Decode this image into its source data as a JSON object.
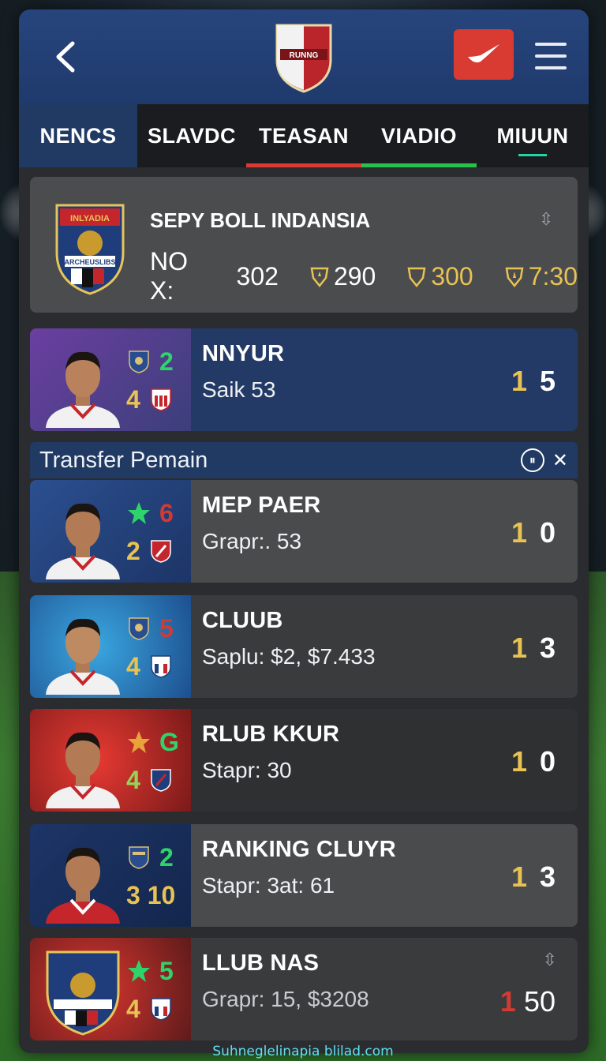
{
  "header": {
    "back_icon": "back-arrow-icon",
    "action_icon": "check-swoosh-icon",
    "menu_icon": "hamburger-menu-icon"
  },
  "tabs": [
    {
      "label": "NENCS",
      "active": true
    },
    {
      "label": "SLAVDC"
    },
    {
      "label": "TEASAN",
      "underline": "#d93a32"
    },
    {
      "label": "VIADIO",
      "underline": "#27c24a"
    },
    {
      "label": "MIUUN",
      "indicator": "#25d3a8"
    }
  ],
  "summary": {
    "title": "SEPY BOLL INDANSIA",
    "crest_text": "INLYADIA",
    "crest_sub": "ARCHEUSLIBS",
    "label": "NO X:",
    "values": [
      "302",
      "290",
      "300",
      "7:30"
    ]
  },
  "players": [
    {
      "title": "NNYUR",
      "sub": "Saik 53",
      "top_num": "2",
      "top_color": "#2ed46a",
      "bot_num": "4",
      "bot_color": "#e8c253",
      "score_a": "1",
      "score_b": "5"
    }
  ],
  "transfer": {
    "heading": "Transfer Pemain"
  },
  "transfers": [
    {
      "title": "MEP PAER",
      "sub": "Grapr:. 53",
      "top_num": "6",
      "top_color": "#d33a32",
      "bot_num": "2",
      "bot_color": "#e8c253",
      "score_a": "1",
      "score_b": "0"
    },
    {
      "title": "CLUUB",
      "sub": "Saplu:  $2, $7.433",
      "top_num": "5",
      "top_color": "#d33a32",
      "bot_num": "4",
      "bot_color": "#e8c253",
      "score_a": "1",
      "score_b": "3"
    },
    {
      "title": "RLUB KKUR",
      "sub": "Stapr: 30",
      "top_num": "G",
      "top_color": "#2ed46a",
      "bot_num": "4",
      "bot_color": "#9ad05a",
      "score_a": "1",
      "score_b": "0"
    },
    {
      "title": "RANKING CLUYR",
      "sub": "Stapr: 3at: 61",
      "top_num": "2",
      "top_color": "#2ed46a",
      "bot_num": "3 10",
      "bot_color": "#e8c253",
      "score_a": "1",
      "score_b": "3"
    },
    {
      "title": "LLUB NAS",
      "sub": "Grapr: 15, $3208",
      "top_num": "5",
      "top_color": "#2ed46a",
      "bot_num": "4",
      "bot_color": "#e8c253",
      "score_a": "1",
      "score_b": "50"
    }
  ],
  "footer": "Suhneglelinapia blilad.com"
}
